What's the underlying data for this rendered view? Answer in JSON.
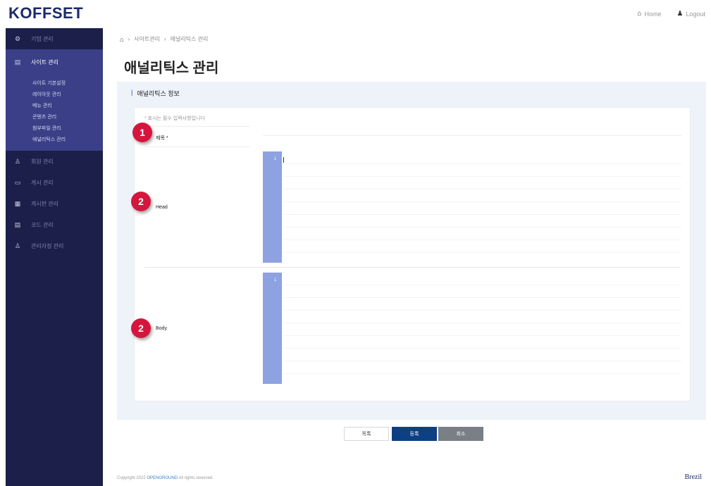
{
  "logo": "KOFFSET",
  "top_links": {
    "home": "Home",
    "logout": "Logout"
  },
  "sidebar": {
    "items": [
      {
        "icon": "gear-icon",
        "label": "기업 관리"
      },
      {
        "icon": "document-icon",
        "label": "사이트 관리",
        "active": true
      },
      {
        "icon": "user-icon",
        "label": "회원 관리"
      },
      {
        "icon": "card-icon",
        "label": "게시 관리"
      },
      {
        "icon": "calendar-icon",
        "label": "게시판 관리"
      },
      {
        "icon": "document-icon",
        "label": "코드 관리"
      },
      {
        "icon": "user-icon",
        "label": "관리자정 관리"
      }
    ],
    "subitems": [
      "사이트 기본설정",
      "레이아웃 관리",
      "메뉴 관리",
      "콘텐츠 관리",
      "첨부파일 관리",
      "애널리틱스 관리"
    ]
  },
  "breadcrumb": [
    "사이트관리",
    "애널리틱스 관리"
  ],
  "page_title": "애널리틱스 관리",
  "panel_title": "애널리틱스 정보",
  "required_note": "* 표시는 필수 입력사항입니다",
  "fields": {
    "title": "제목 *",
    "head": "Head",
    "body": "Body"
  },
  "code": {
    "head_line": "1",
    "body_line": "1"
  },
  "buttons": {
    "list": "목록",
    "save": "등록",
    "cancel": "취소"
  },
  "footer": {
    "prefix": "Copyright 2022",
    "company": "OPENGROUND",
    "suffix": "All rights reserved."
  },
  "brand": "Brezil",
  "badges": [
    "1",
    "2",
    "2"
  ],
  "colors": {
    "sidebar": "#1b1f4a",
    "sidebar_active": "#3a3f87",
    "badge": "#d6153c",
    "gutter": "#8ea1e1",
    "save": "#0f3f83",
    "cancel": "#7a7f86"
  }
}
